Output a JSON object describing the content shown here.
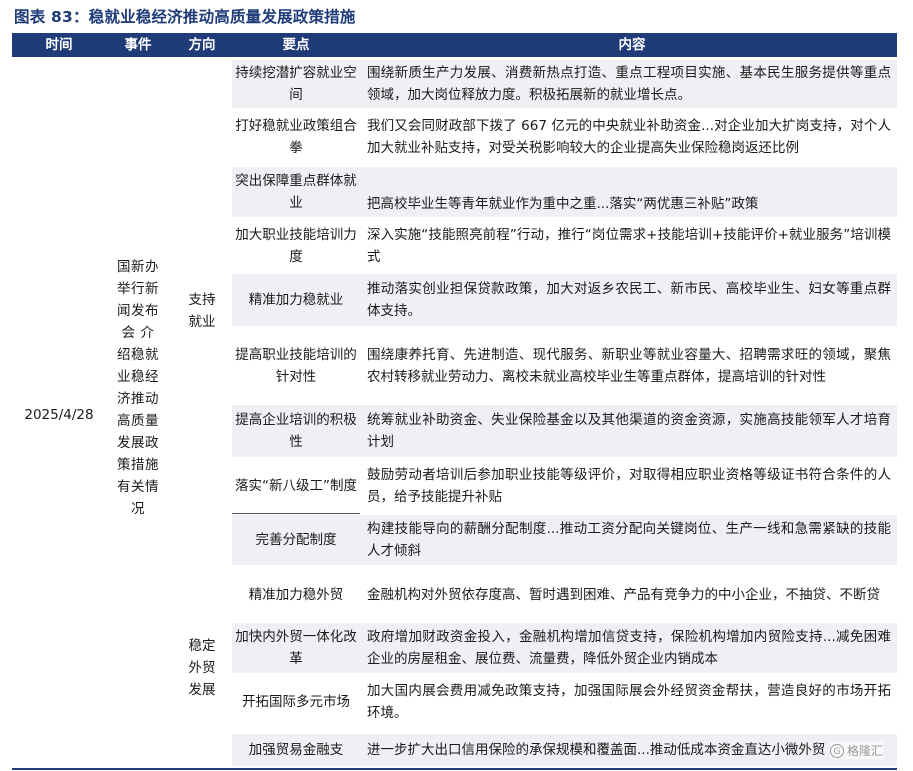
{
  "title": "图表 83：稳就业稳经济推动高质量发展政策措施",
  "header": {
    "time": "时间",
    "event": "事件",
    "direction": "方向",
    "key_point": "要点",
    "content": "内容"
  },
  "time": "2025/4/28",
  "event": "国新办举行新闻发布会介绍稳就业稳经济推动高质量发展政策措施有关情况",
  "event_lines": [
    "国新办",
    "举行新",
    "闻发布",
    "会 介",
    "绍稳就",
    "业稳经",
    "济推动",
    "高质量",
    "发展政",
    "策措施",
    "有关情",
    "况"
  ],
  "directions": {
    "employment": [
      "支持",
      "就业"
    ],
    "trade": [
      "稳定",
      "外贸",
      "发展"
    ]
  },
  "rows": [
    {
      "key": "持续挖潜扩容就业空间",
      "content": "围绕新质生产力发展、消费新热点打造、重点工程项目实施、基本民生服务提供等重点领域，加大岗位释放力度。积极拓展新的就业增长点。"
    },
    {
      "key": "打好稳就业政策组合拳",
      "content": "我们又会同财政部下拨了 667 亿元的中央就业补助资金...对企业加大扩岗支持，对个人加大就业补贴支持，对受关税影响较大的企业提高失业保险稳岗返还比例"
    },
    {
      "key": "突出保障重点群体就业",
      "content": "把高校毕业生等青年就业作为重中之重...落实“两优惠三补贴”政策"
    },
    {
      "key": "加大职业技能培训力度",
      "content": "深入实施“技能照亮前程”行动，推行“岗位需求+技能培训+技能评价+就业服务”培训模式"
    },
    {
      "key": "精准加力稳就业",
      "content": "推动落实创业担保贷款政策，加大对返乡农民工、新市民、高校毕业生、妇女等重点群体支持。"
    },
    {
      "key": "提高职业技能培训的针对性",
      "content": "围绕康养托育、先进制造、现代服务、新职业等就业容量大、招聘需求旺的领域，聚焦农村转移就业劳动力、离校未就业高校毕业生等重点群体，提高培训的针对性"
    },
    {
      "key": "提高企业培训的积极性",
      "content": "统筹就业补助资金、失业保险基金以及其他渠道的资金资源，实施高技能领军人才培育计划"
    },
    {
      "key": "落实“新八级工”制度",
      "content": "鼓励劳动者培训后参加职业技能等级评价，对取得相应职业资格等级证书符合条件的人员，给予技能提升补贴"
    },
    {
      "key": "完善分配制度",
      "content": "构建技能导向的薪酬分配制度...推动工资分配向关键岗位、生产一线和急需紧缺的技能人才倾斜"
    },
    {
      "key": "精准加力稳外贸",
      "content": "金融机构对外贸依存度高、暂时遇到困难、产品有竞争力的中小企业，不抽贷、不断贷"
    },
    {
      "key": "加快内外贸一体化改革",
      "content": "政府增加财政资金投入，金融机构增加信贷支持，保险机构增加内贸险支持...减免困难企业的房屋租金、展位费、流量费，降低外贸企业内销成本"
    },
    {
      "key": "开拓国际多元市场",
      "content": "加大国内展会费用减免政策支持，加强国际展会外经贸资金帮扶，营造良好的市场开拓环境。"
    },
    {
      "key": "加强贸易金融支",
      "content": "进一步扩大出口信用保险的承保规模和覆盖面...推动低成本资金直达小微外贸"
    }
  ],
  "watermark": "格隆汇",
  "colors": {
    "header_bg": "#1f3b78",
    "title": "#1f3b78",
    "row_shade": "#eef0f4"
  }
}
